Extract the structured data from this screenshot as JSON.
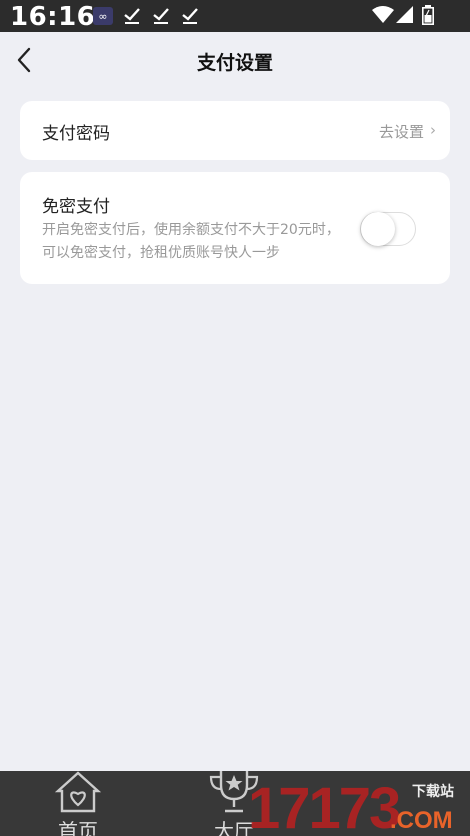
{
  "status_bar": {
    "time": "16:16",
    "icons": [
      "infinity-app-icon",
      "check-icon",
      "check-icon",
      "check-icon",
      "wifi-icon",
      "signal-icon",
      "battery-icon"
    ]
  },
  "nav": {
    "title": "支付设置",
    "back_icon": "back-arrow-icon"
  },
  "payment_password": {
    "label": "支付密码",
    "value": "去设置",
    "chevron": "›"
  },
  "password_free": {
    "label": "免密支付",
    "description": "开启免密支付后，使用余额支付不大于20元时，可以免密支付，抢租优质账号快人一步",
    "enabled": false
  },
  "bottom_tabs": [
    {
      "label": "首页",
      "icon": "home-icon"
    },
    {
      "label": "大厅",
      "icon": "trophy-icon"
    }
  ],
  "watermark": {
    "number": "17173",
    "site_label": "下载站",
    "domain": ".COM"
  },
  "colors": {
    "background": "#eeeff4",
    "card": "#ffffff",
    "status_bar": "#2c2c2c",
    "bottom_bar": "#383838",
    "muted_text": "#999999"
  }
}
